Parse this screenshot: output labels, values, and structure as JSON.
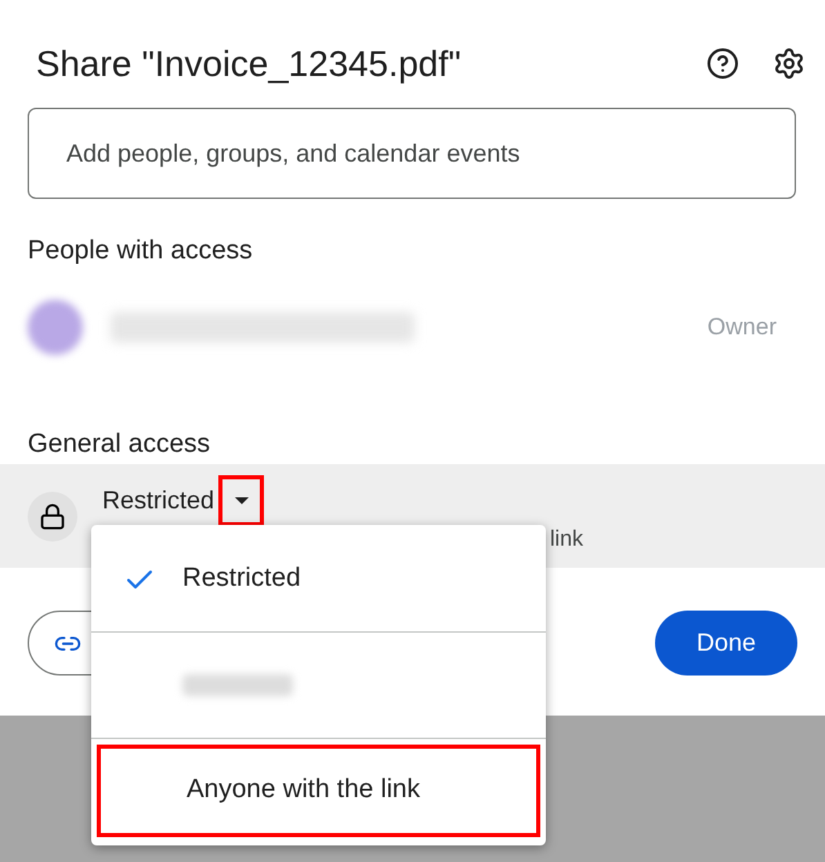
{
  "dialog": {
    "title": "Share \"Invoice_12345.pdf\"",
    "input": {
      "placeholder": "Add people, groups, and calendar events"
    }
  },
  "people": {
    "heading": "People with access",
    "rows": [
      {
        "kind": "blurred",
        "role": "Owner"
      }
    ]
  },
  "general_access": {
    "heading": "General access",
    "value": "Restricted",
    "caret_highlighted": true,
    "description": "link"
  },
  "done_button": "Done",
  "menu": [
    {
      "kind": "text",
      "label": "Restricted",
      "selected": true,
      "highlighted": false
    },
    {
      "kind": "blurred",
      "selected": false,
      "highlighted": false
    },
    {
      "kind": "text",
      "label": "Anyone with the link",
      "selected": false,
      "highlighted": true
    }
  ]
}
